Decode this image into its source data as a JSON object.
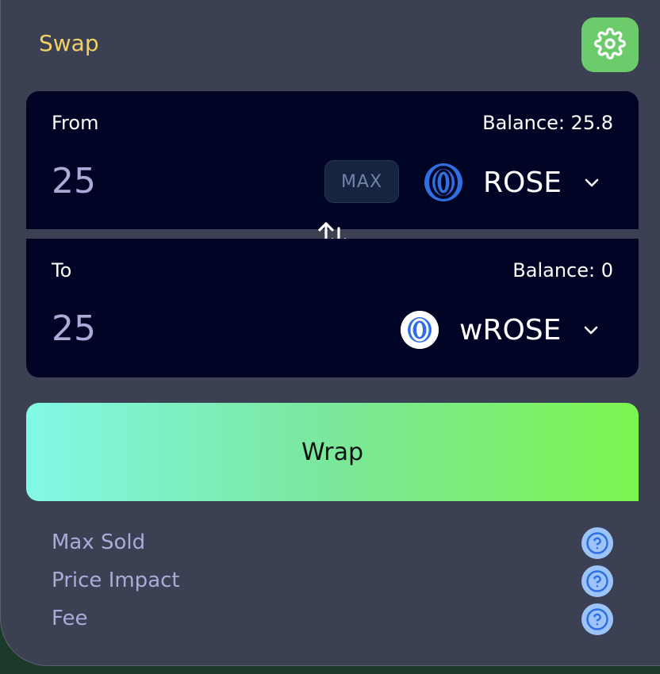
{
  "header": {
    "title": "Swap",
    "settings_icon": "gear-icon"
  },
  "from": {
    "label": "From",
    "balance": "Balance: 25.8",
    "amount": "25",
    "max_label": "MAX",
    "token": "ROSE",
    "token_icon": "rose-token-icon"
  },
  "switch_icon": "swap-arrows-icon",
  "to": {
    "label": "To",
    "balance": "Balance: 0",
    "amount": "25",
    "token": "wROSE",
    "token_icon": "wrose-token-icon"
  },
  "action": {
    "label": "Wrap"
  },
  "details": [
    {
      "label": "Max Sold"
    },
    {
      "label": "Price Impact"
    },
    {
      "label": "Fee"
    }
  ],
  "colors": {
    "card_bg": "#3b4153",
    "panel_bg": "#000525",
    "title": "#f4cf63",
    "settings_bg": "#6ccb6a",
    "token_blue": "#2f6fe0",
    "gradient_start": "#82f8e6",
    "gradient_end": "#7bf54f"
  }
}
